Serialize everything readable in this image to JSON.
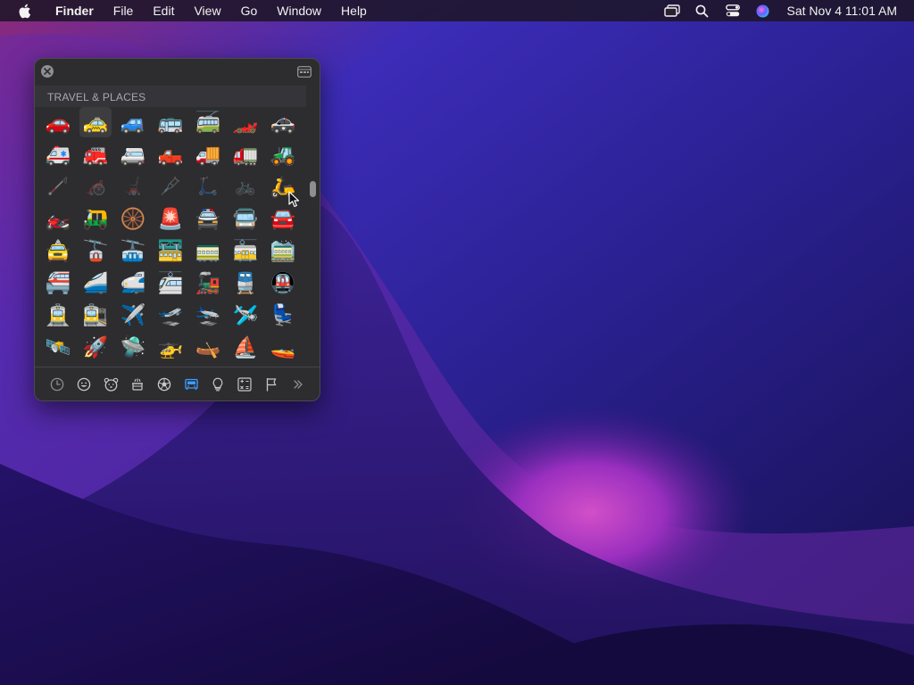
{
  "menubar": {
    "app_name": "Finder",
    "menus": [
      "File",
      "Edit",
      "View",
      "Go",
      "Window",
      "Help"
    ],
    "status_icons": [
      "screen-mirroring-icon",
      "spotlight-search-icon",
      "control-center-icon",
      "siri-icon"
    ],
    "clock": "Sat Nov 4  11:01 AM"
  },
  "character_viewer": {
    "section_title": "TRAVEL & PLACES",
    "emoji_rows": [
      [
        "🚗",
        "🚕",
        "🚙",
        "🚌",
        "🚎",
        "🏎️",
        "🚓"
      ],
      [
        "🚑",
        "🚒",
        "🚐",
        "🛻",
        "🚚",
        "🚛",
        "🚜"
      ],
      [
        "🦯",
        "🦽",
        "🦼",
        "🩼",
        "🛴",
        "🚲",
        "🛵"
      ],
      [
        "🏍️",
        "🛺",
        "🛞",
        "🚨",
        "🚔",
        "🚍",
        "🚘"
      ],
      [
        "🚖",
        "🚡",
        "🚠",
        "🚟",
        "🚃",
        "🚋",
        "🚞"
      ],
      [
        "🚝",
        "🚄",
        "🚅",
        "🚈",
        "🚂",
        "🚆",
        "🚇"
      ],
      [
        "🚊",
        "🚉",
        "✈️",
        "🛫",
        "🛬",
        "🛩️",
        "💺"
      ],
      [
        "🛰️",
        "🚀",
        "🛸",
        "🚁",
        "🛶",
        "⛵",
        "🚤"
      ]
    ],
    "selected_emoji": "🚕",
    "categories": [
      "recent-icon",
      "smileys-icon",
      "animals-icon",
      "food-icon",
      "activity-icon",
      "travel-icon",
      "objects-icon",
      "symbols-icon",
      "flags-icon",
      "more-icon"
    ],
    "active_category": "travel-icon",
    "scroll_fraction": 0.28
  }
}
